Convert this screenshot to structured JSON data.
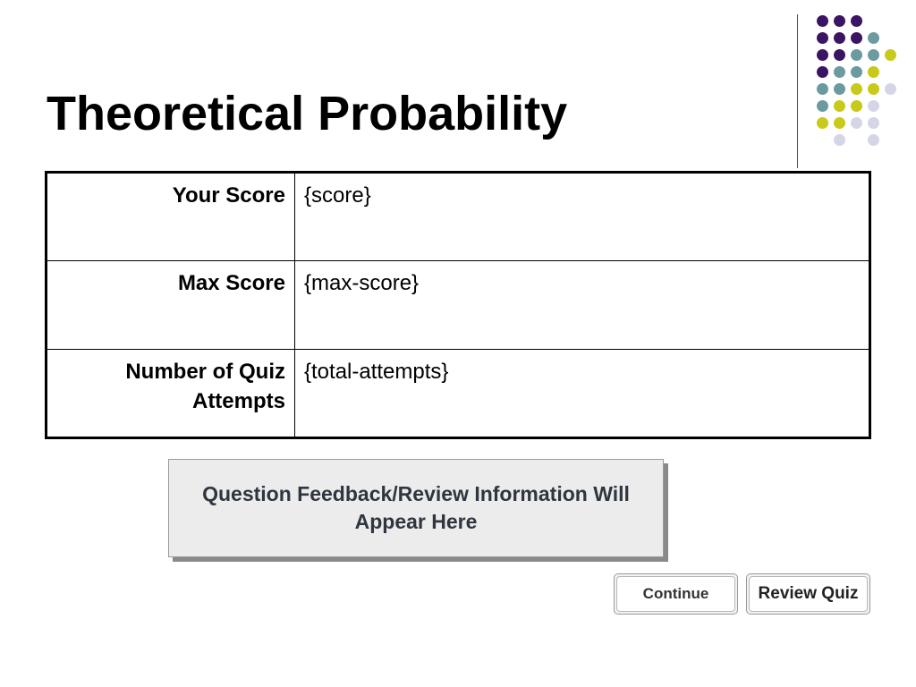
{
  "slide": {
    "title": "Theoretical Probability"
  },
  "decoration": {
    "dot_colors": {
      "purple": "#3b1563",
      "teal": "#6b9ba0",
      "yellow": "#c9c919",
      "lavender": "#d5d5e8"
    }
  },
  "results": {
    "rows": [
      {
        "label": "Your Score",
        "value": "{score}"
      },
      {
        "label": "Max Score",
        "value": "{max-score}"
      },
      {
        "label": "Number of Quiz Attempts",
        "value": "{total-attempts}"
      }
    ]
  },
  "feedback": {
    "text": "Question Feedback/Review Information Will Appear Here"
  },
  "buttons": {
    "continue": "Continue",
    "review_quiz": "Review Quiz"
  }
}
